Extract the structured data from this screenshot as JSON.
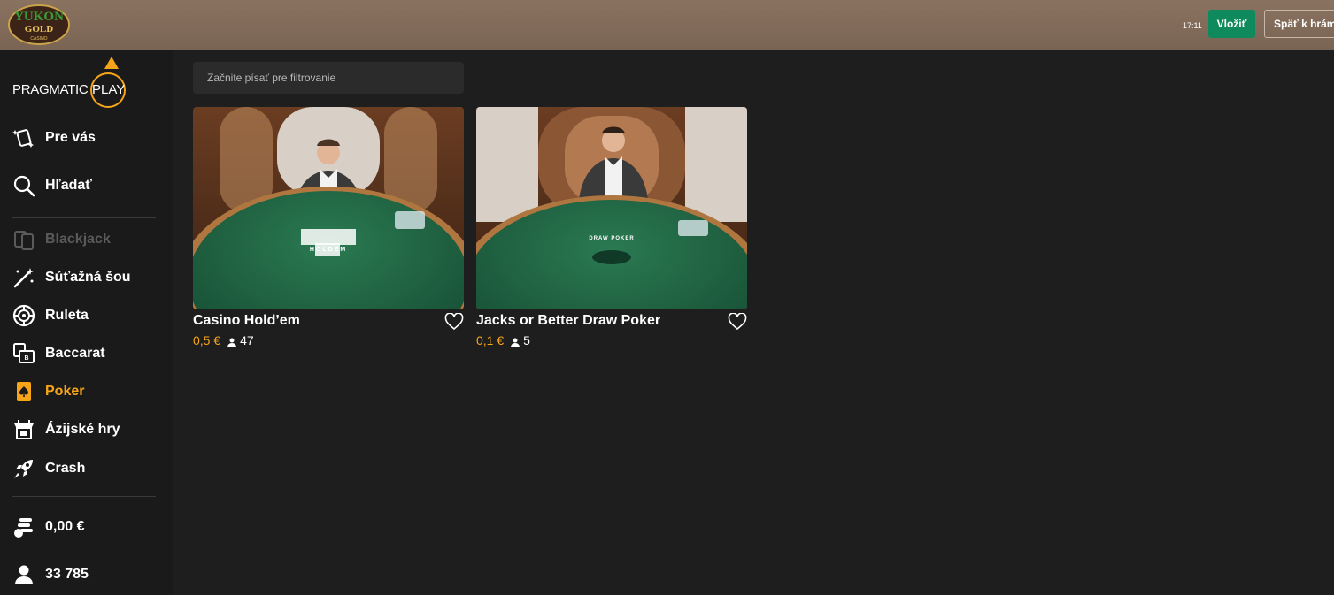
{
  "header": {
    "casino_logo_text_line1": "YUKON",
    "casino_logo_text_line2": "GOLD",
    "casino_logo_text_line3": "CASINO",
    "clock": "17:11",
    "deposit_label": "Vložiť",
    "back_label": "Späť k hrám"
  },
  "sidebar": {
    "provider_logo_left": "PRAGMATIC",
    "provider_logo_right": "PLAY",
    "top_items": [
      {
        "label": "Pre vás",
        "icon": "sparkle-cards-icon"
      },
      {
        "label": "Hľadať",
        "icon": "search-icon"
      }
    ],
    "categories": [
      {
        "label": "Blackjack",
        "icon": "blackjack-cards-icon",
        "state": "disabled"
      },
      {
        "label": "Súťažná šou",
        "icon": "magic-wand-icon",
        "state": "normal"
      },
      {
        "label": "Ruleta",
        "icon": "roulette-wheel-icon",
        "state": "normal"
      },
      {
        "label": "Baccarat",
        "icon": "baccarat-icon",
        "state": "normal"
      },
      {
        "label": "Poker",
        "icon": "poker-card-icon",
        "state": "active"
      },
      {
        "label": "Ázijské hry",
        "icon": "asian-games-icon",
        "state": "normal"
      },
      {
        "label": "Crash",
        "icon": "rocket-icon",
        "state": "normal"
      }
    ],
    "balance": "0,00 €",
    "online_players": "33 785"
  },
  "filter": {
    "placeholder": "Začnite písať pre filtrovanie"
  },
  "games": [
    {
      "title": "Casino Hold’em",
      "min_bet": "0,5 €",
      "players": "47",
      "table_text": "HOLDEM"
    },
    {
      "title": "Jacks or Better Draw Poker",
      "min_bet": "0,1 €",
      "players": "5",
      "table_text": "DRAW POKER"
    }
  ],
  "colors": {
    "accent": "#f7a518",
    "deposit": "#0f8a5c",
    "header_bg": "#7f6957",
    "table_felt": "#1f5c3f"
  }
}
